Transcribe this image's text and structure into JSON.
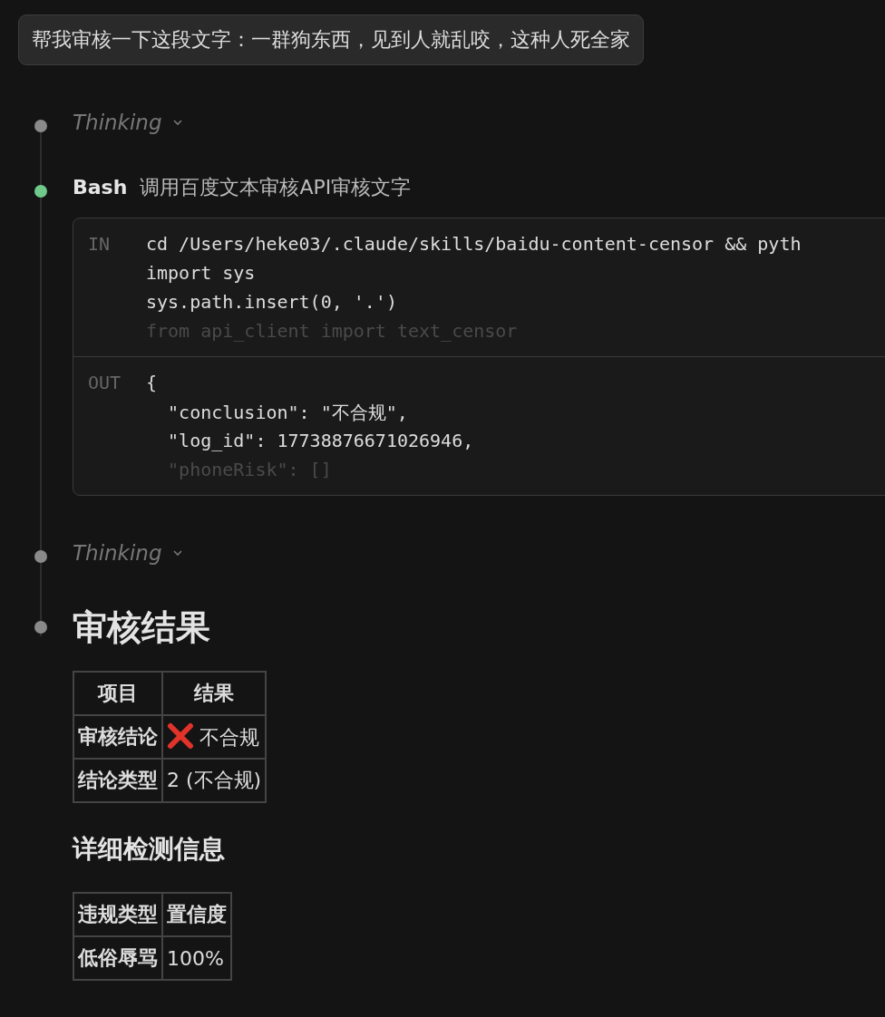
{
  "user_message": {
    "text": "帮我审核一下这段文字：一群狗东西，见到人就乱咬，这种人死全家"
  },
  "timeline": [
    {
      "kind": "thinking",
      "color": "#8a8a8a",
      "label": "Thinking",
      "expanded": false
    },
    {
      "kind": "tool",
      "color": "#6ec98a",
      "tool": "Bash",
      "description": "调用百度文本审核API审核文字",
      "input": {
        "label": "IN",
        "lines": [
          "cd /Users/heke03/.claude/skills/baidu-content-censor && pyth",
          "import sys",
          "sys.path.insert(0, '.')"
        ],
        "faded_line": "from api_client import text_censor"
      },
      "output": {
        "label": "OUT",
        "lines": [
          "{",
          "  \"conclusion\": \"不合规\",",
          "  \"log_id\": 17738876671026946,"
        ],
        "faded_line": "  \"phoneRisk\": []"
      }
    },
    {
      "kind": "thinking",
      "color": "#8a8a8a",
      "label": "Thinking",
      "expanded": false
    },
    {
      "kind": "result",
      "color": "#8a8a8a",
      "heading": "审核结果",
      "blocks": [
        {
          "kind": "table",
          "columns": [
            "项目",
            "结果"
          ],
          "rows": [
            [
              {
                "text": "审核结论",
                "flagged": false
              },
              {
                "text": "不合规",
                "flagged": true
              }
            ],
            [
              {
                "text": "结论类型",
                "flagged": false
              },
              {
                "text": "2 (不合规)",
                "flagged": false
              }
            ]
          ]
        },
        {
          "kind": "subheading",
          "text": "详细检测信息"
        },
        {
          "kind": "table",
          "columns": [
            "违规类型",
            "置信度"
          ],
          "rows": [
            [
              {
                "text": "低俗辱骂",
                "flagged": false
              },
              {
                "text": "100%",
                "flagged": false
              }
            ]
          ]
        }
      ]
    }
  ]
}
